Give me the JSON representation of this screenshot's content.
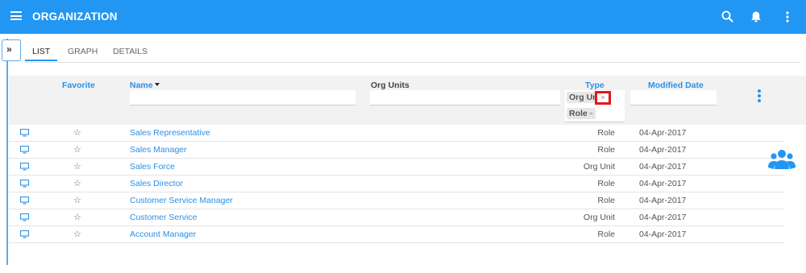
{
  "app": {
    "title": "ORGANIZATION",
    "accent_color": "#2196f3",
    "icons": [
      "menu-icon",
      "search-icon",
      "bell-icon",
      "more-vertical-icon"
    ]
  },
  "tabs": [
    {
      "label": "LIST",
      "active": true
    },
    {
      "label": "GRAPH",
      "active": false
    },
    {
      "label": "DETAILS",
      "active": false
    }
  ],
  "grid": {
    "columns": {
      "favorite": "Favorite",
      "name": "Name",
      "org_units": "Org Units",
      "type": "Type",
      "modified": "Modified Date"
    },
    "filters": {
      "name": "",
      "org_units": "",
      "modified": "",
      "type_chips": [
        {
          "label": "Org Unit",
          "remove": "×"
        },
        {
          "label": "Role",
          "remove": "×"
        }
      ]
    },
    "sort": {
      "column": "name",
      "direction": "descending"
    },
    "rows": [
      {
        "name": "Sales Representative",
        "type": "Role",
        "modified": "04-Apr-2017",
        "favorite": false
      },
      {
        "name": "Sales Manager",
        "type": "Role",
        "modified": "04-Apr-2017",
        "favorite": false
      },
      {
        "name": "Sales Force",
        "type": "Org Unit",
        "modified": "04-Apr-2017",
        "favorite": false
      },
      {
        "name": "Sales Director",
        "type": "Role",
        "modified": "04-Apr-2017",
        "favorite": false
      },
      {
        "name": "Customer Service Manager",
        "type": "Role",
        "modified": "04-Apr-2017",
        "favorite": false
      },
      {
        "name": "Customer Service",
        "type": "Org Unit",
        "modified": "04-Apr-2017",
        "favorite": false
      },
      {
        "name": "Account Manager",
        "type": "Role",
        "modified": "04-Apr-2017",
        "favorite": false
      }
    ]
  },
  "glyphs": {
    "expand": "»",
    "star": "☆"
  }
}
